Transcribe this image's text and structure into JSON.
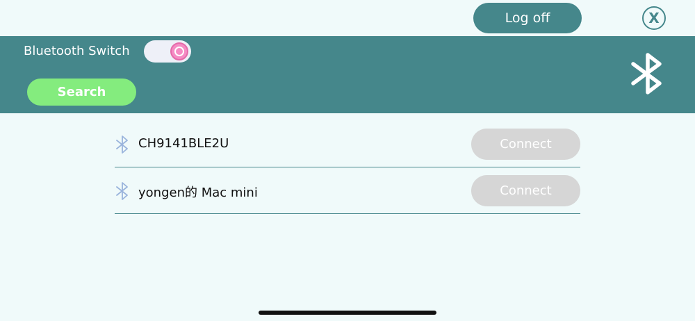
{
  "header": {
    "logoff_label": "Log off",
    "close_label": "X"
  },
  "panel": {
    "bluetooth_switch_label": "Bluetooth Switch",
    "bluetooth_switch_on": true,
    "search_label": "Search",
    "bluetooth_icon": "bluetooth-icon"
  },
  "devices": [
    {
      "name": "CH9141BLE2U",
      "connect_label": "Connect",
      "icon": "bluetooth-icon"
    },
    {
      "name": "yongen的 Mac mini",
      "connect_label": "Connect",
      "icon": "bluetooth-icon"
    }
  ],
  "colors": {
    "primary": "#45878b",
    "background": "#f0fafa",
    "search": "#84ec7e",
    "toggle_knob": "#f58bc4",
    "connect_disabled": "#d6d6d6",
    "device_icon": "#9ab4dc"
  }
}
